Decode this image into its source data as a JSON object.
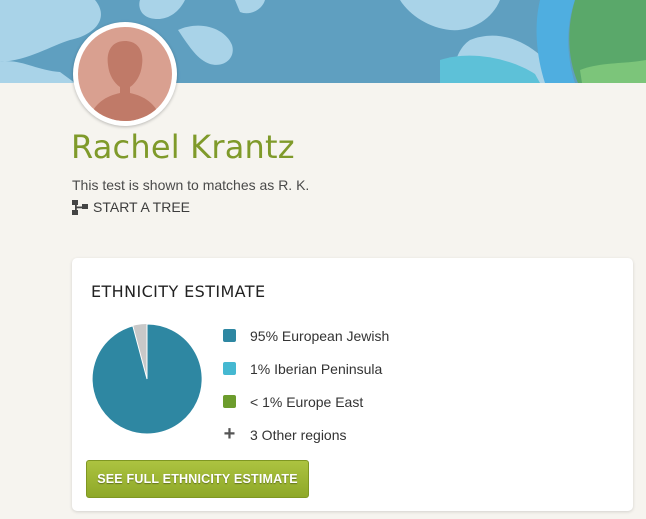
{
  "profile": {
    "name": "Rachel Krantz",
    "privacy_note": "This test is shown to matches as R. K.",
    "start_tree_label": "START A TREE"
  },
  "ethnicity": {
    "title": "ETHNICITY ESTIMATE",
    "legend": [
      {
        "label": "95% European Jewish",
        "color": "#2e87a2"
      },
      {
        "label": "1% Iberian Peninsula",
        "color": "#45b8d1"
      },
      {
        "label": "< 1% Europe East",
        "color": "#6c9c2c"
      }
    ],
    "other_label": "3 Other regions",
    "button_label": "SEE FULL ETHNICITY ESTIMATE"
  },
  "colors": {
    "name_green": "#7f9a2a",
    "pie_main": "#2e87a2",
    "pie_rest": "#c8c8c8",
    "button_green": "#9db535"
  }
}
